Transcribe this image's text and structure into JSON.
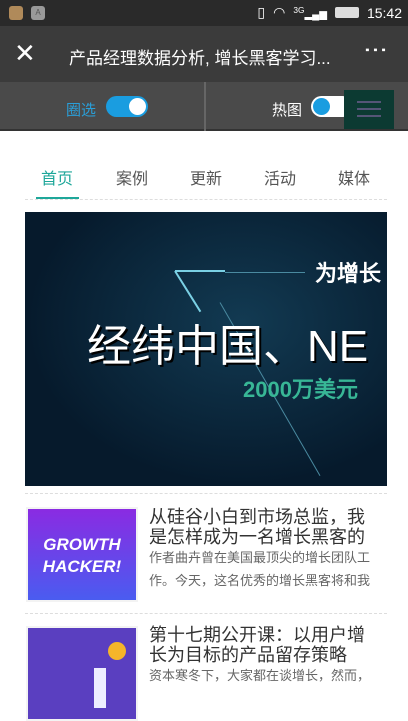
{
  "status": {
    "time": "15:42",
    "network": "3G"
  },
  "toolbar": {
    "title": "产品经理数据分析, 增长黑客学习..."
  },
  "toggles": {
    "circle_label": "圈选",
    "circle_on": true,
    "heatmap_label": "热图",
    "heatmap_on": false
  },
  "tabs": [
    {
      "label": "首页",
      "active": true
    },
    {
      "label": "案例"
    },
    {
      "label": "更新"
    },
    {
      "label": "活动"
    },
    {
      "label": "媒体"
    }
  ],
  "banner": {
    "line1": "为增长",
    "line2": "经纬中国、NE",
    "line3": "2000万美元"
  },
  "articles": [
    {
      "title": "从硅谷小白到市场总监，我是怎样成为一名增长黑客的",
      "desc": "作者曲卉曾在美国最顶尖的增长团队工作。今天，这名优秀的增长黑客将和我",
      "thumb_text": "GROWTH HACKER!"
    },
    {
      "title": "第十七期公开课：以用户增长为目标的产品留存策略",
      "desc": "资本寒冬下，大家都在谈增长，然而，"
    }
  ]
}
